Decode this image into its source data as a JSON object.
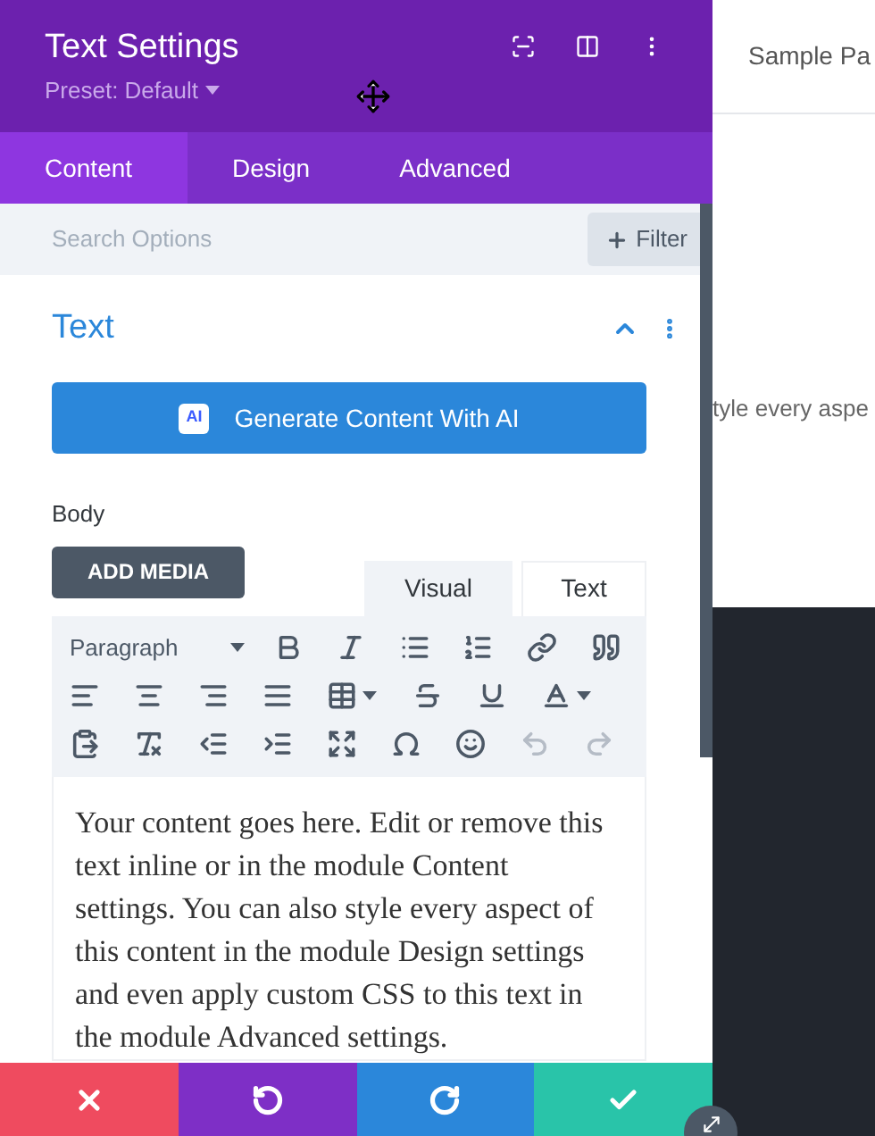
{
  "window": {
    "title": "Text Settings",
    "preset": "Preset: Default"
  },
  "tabs": [
    {
      "label": "Content",
      "selected": true
    },
    {
      "label": "Design",
      "selected": false
    },
    {
      "label": "Advanced",
      "selected": false
    }
  ],
  "search": {
    "placeholder": "Search Options",
    "filter": "Filter"
  },
  "section": {
    "title": "Text",
    "expanded": true
  },
  "ai_button": {
    "badge": "AI",
    "label": "Generate Content With AI"
  },
  "body_label": "Body",
  "add_media": "ADD MEDIA",
  "editor_tabs": [
    {
      "label": "Visual",
      "selected": true
    },
    {
      "label": "Text",
      "selected": false
    }
  ],
  "toolbar": {
    "format": "Paragraph",
    "rows": [
      [
        {
          "kind": "bold",
          "disabled": false
        },
        {
          "kind": "italic",
          "disabled": false
        },
        {
          "kind": "bullet-list",
          "disabled": false
        },
        {
          "kind": "numbered-list",
          "disabled": false
        },
        {
          "kind": "link",
          "disabled": false
        },
        {
          "kind": "quote",
          "disabled": false
        }
      ],
      [
        {
          "kind": "align-left",
          "disabled": false
        },
        {
          "kind": "align-center",
          "disabled": false
        },
        {
          "kind": "align-right",
          "disabled": false
        },
        {
          "kind": "justify",
          "disabled": false
        },
        {
          "kind": "table",
          "disabled": false,
          "menu": true
        },
        {
          "kind": "strikethrough",
          "disabled": false
        },
        {
          "kind": "underline",
          "disabled": false
        },
        {
          "kind": "text-color",
          "disabled": false,
          "menu": true
        }
      ],
      [
        {
          "kind": "paste-text",
          "disabled": false
        },
        {
          "kind": "clear-format",
          "disabled": false
        },
        {
          "kind": "outdent",
          "disabled": false
        },
        {
          "kind": "indent",
          "disabled": false
        },
        {
          "kind": "fullscreen",
          "disabled": false
        },
        {
          "kind": "symbol",
          "disabled": false
        },
        {
          "kind": "emoji",
          "disabled": false
        },
        {
          "kind": "undo",
          "disabled": true
        },
        {
          "kind": "redo",
          "disabled": true
        }
      ]
    ]
  },
  "content": "Your content goes here. Edit or remove this text inline or in the module Content settings. You can also style every aspect of this content in the module Design settings and even apply custom CSS to this text in the module Advanced settings.",
  "footer": [
    {
      "kind": "discard"
    },
    {
      "kind": "undo"
    },
    {
      "kind": "redo"
    },
    {
      "kind": "save"
    }
  ],
  "background_page": {
    "nav_item": "Sample Pa",
    "text_fragment": "tyle every aspe"
  }
}
